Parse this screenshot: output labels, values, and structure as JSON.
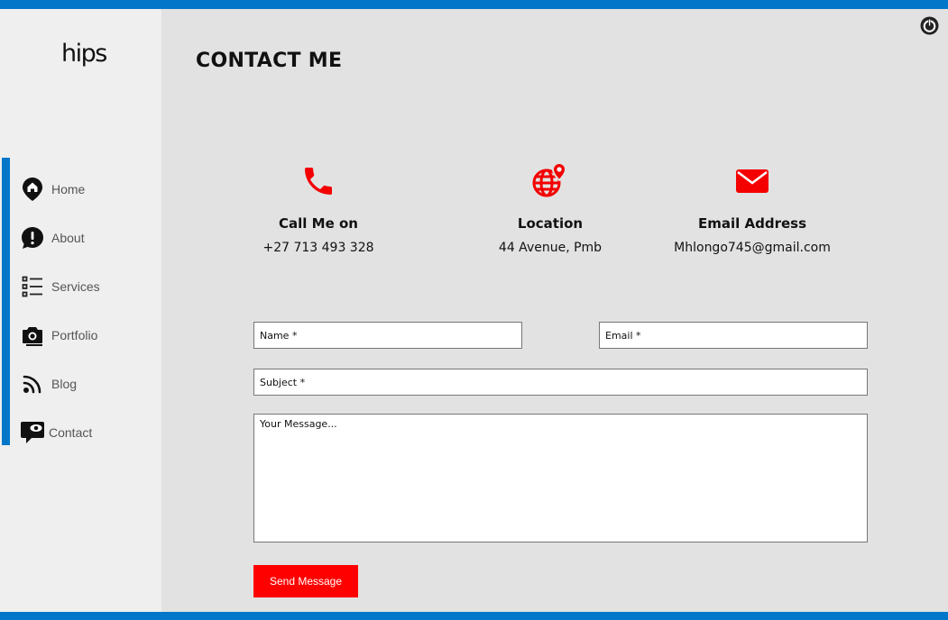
{
  "brand": {
    "logo_text": "hips"
  },
  "sidebar": {
    "items": [
      {
        "label": "Home",
        "icon": "home-pin-icon"
      },
      {
        "label": "About",
        "icon": "info-bubble-icon"
      },
      {
        "label": "Services",
        "icon": "list-icon"
      },
      {
        "label": "Portfolio",
        "icon": "camera-icon"
      },
      {
        "label": "Blog",
        "icon": "feed-icon"
      },
      {
        "label": "Contact",
        "icon": "contact-bubble-icon"
      }
    ]
  },
  "header": {
    "title": "CONTACT ME",
    "power_icon": "power-icon"
  },
  "contact_info": [
    {
      "title": "Call Me on",
      "value": "+27 713 493 328",
      "icon": "phone-icon"
    },
    {
      "title": "Location",
      "value": "44 Avenue, Pmb",
      "icon": "globe-pin-icon"
    },
    {
      "title": "Email Address",
      "value": "Mhlongo745@gmail.com",
      "icon": "envelope-icon"
    }
  ],
  "form": {
    "name_placeholder": "Name *",
    "email_placeholder": "Email *",
    "subject_placeholder": "Subject *",
    "message_placeholder": "Your Message...",
    "submit_label": "Send Message"
  },
  "colors": {
    "accent": "#0277c9",
    "highlight": "#ff0000",
    "background": "#e2e2e2",
    "sidebar": "#efefef"
  }
}
